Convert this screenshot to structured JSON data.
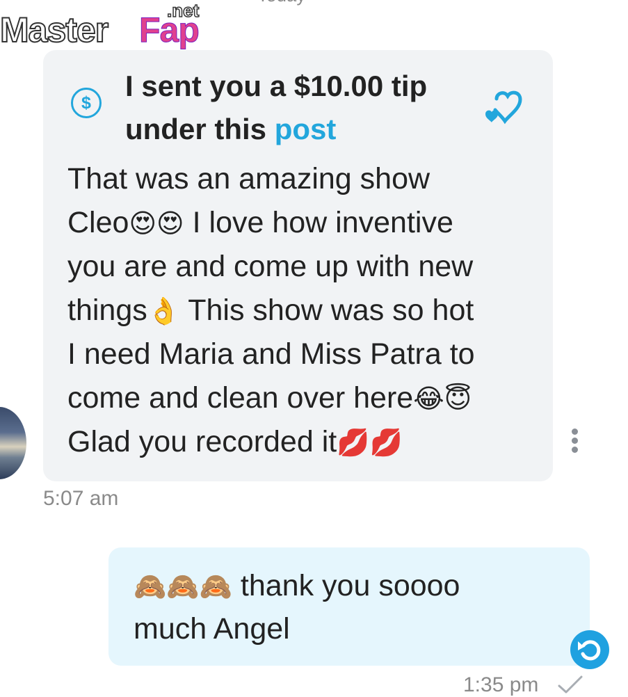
{
  "header": {
    "date_label": "Today"
  },
  "watermark": {
    "part1": "Master",
    "part2": "Fap",
    "suffix": ".net"
  },
  "incoming": {
    "tip_text_1": "I sent you a $10.00 tip",
    "tip_text_2": "under this",
    "tip_link": "post",
    "tip_icon_symbol": "$",
    "lines": [
      {
        "text": "That was an amazing show",
        "emoji": ""
      },
      {
        "text": "Cleo",
        "emoji": "😍😍",
        "after": " I love how inventive"
      },
      {
        "text": "you are and come up with new",
        "emoji": ""
      },
      {
        "text": "things",
        "emoji": "👌",
        "after": " This show was so hot"
      },
      {
        "text": "I need Maria and Miss Patra to",
        "emoji": ""
      },
      {
        "text": "come and clean over here",
        "emoji": "😂😇"
      },
      {
        "text": "Glad you recorded it",
        "emoji": "💋💋"
      }
    ],
    "time": "5:07 am"
  },
  "outgoing": {
    "emoji": "🙈🙈🙈",
    "line_1": " thank you soooo",
    "line_2": "much Angel",
    "time": "1:35 pm"
  },
  "icons": {
    "tip": "dollar-circle-icon",
    "heart": "heart-outline-icon",
    "more": "vertical-dots-icon",
    "undo": "undo-icon",
    "read": "check-icon"
  },
  "colors": {
    "accent": "#22a6dc",
    "incoming_bubble": "#f1f3f5",
    "outgoing_bubble": "#e5f6fd",
    "undo_button": "#1fa1e0"
  }
}
